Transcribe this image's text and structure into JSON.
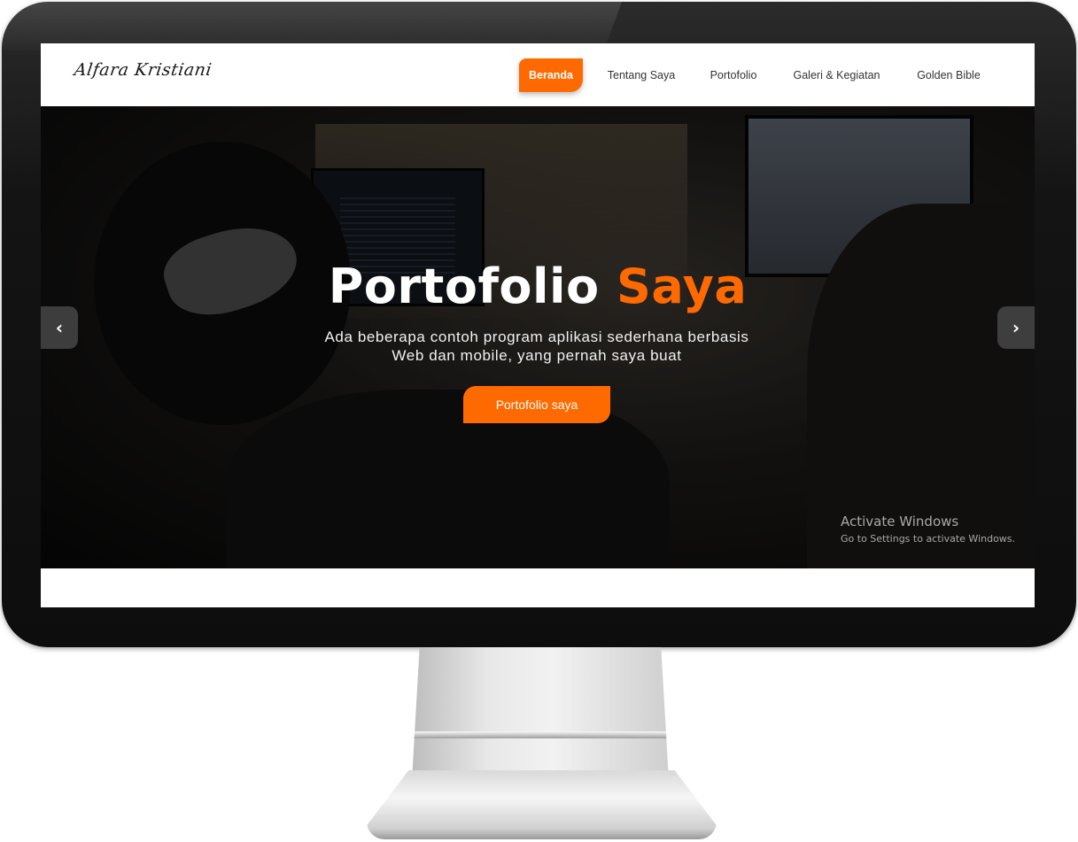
{
  "site": {
    "logo_text": "Alfara Kristiani"
  },
  "nav": {
    "items": [
      {
        "label": "Beranda",
        "active": true
      },
      {
        "label": "Tentang Saya",
        "active": false
      },
      {
        "label": "Portofolio",
        "active": false
      },
      {
        "label": "Galeri & Kegiatan",
        "active": false
      },
      {
        "label": "Golden Bible",
        "active": false
      }
    ]
  },
  "hero": {
    "title_main": "Portofolio",
    "title_accent": "Saya",
    "subtitle_line1": "Ada beberapa contoh program aplikasi sederhana berbasis",
    "subtitle_line2": "Web dan mobile, yang pernah saya buat",
    "button_label": "Portofolio saya",
    "prev_icon": "chevron-left-icon",
    "next_icon": "chevron-right-icon",
    "prev_glyph": "‹",
    "next_glyph": "›"
  },
  "watermark": {
    "line1": "Activate Windows",
    "line2": "Go to Settings to activate Windows."
  },
  "colors": {
    "accent": "#ff6a00",
    "navbar_bg": "#ffffff",
    "bezel": "#111111"
  }
}
